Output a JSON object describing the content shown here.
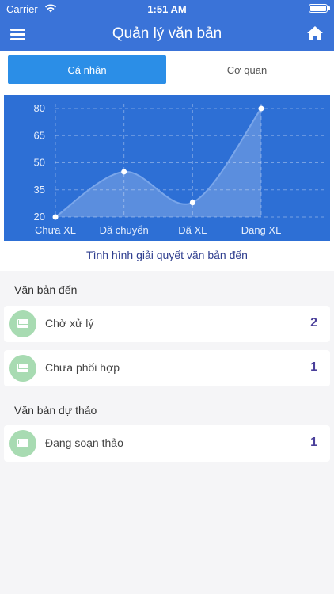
{
  "status_bar": {
    "carrier": "Carrier",
    "time": "1:51 AM"
  },
  "nav": {
    "title": "Quản lý văn bản",
    "menu_icon": "menu-icon",
    "home_icon": "home-icon"
  },
  "tabs": [
    {
      "label": "Cá nhân",
      "active": true
    },
    {
      "label": "Cơ quan",
      "active": false
    }
  ],
  "chart_data": {
    "type": "area",
    "categories": [
      "Chưa XL",
      "Đã chuyển",
      "Đã XL",
      "Đang XL"
    ],
    "values": [
      20,
      45,
      28,
      80
    ],
    "yticks": [
      20,
      35,
      50,
      65,
      80
    ],
    "ylim": [
      20,
      80
    ],
    "title": "Tình hình giải quyết văn bản đến",
    "grid": true,
    "colors": {
      "background": "#2d6fd5",
      "line": "#7aa6ea",
      "fill": "#ffffff",
      "point": "#ffffff"
    }
  },
  "sections": [
    {
      "title": "Văn bản đến",
      "items": [
        {
          "label": "Chờ xử lý",
          "count": "2",
          "icon": "mail-icon"
        },
        {
          "label": "Chưa phối hợp",
          "count": "1",
          "icon": "mail-icon"
        }
      ]
    },
    {
      "title": "Văn bản dự thảo",
      "items": [
        {
          "label": "Đang soạn thảo",
          "count": "1",
          "icon": "mail-icon"
        }
      ]
    }
  ]
}
